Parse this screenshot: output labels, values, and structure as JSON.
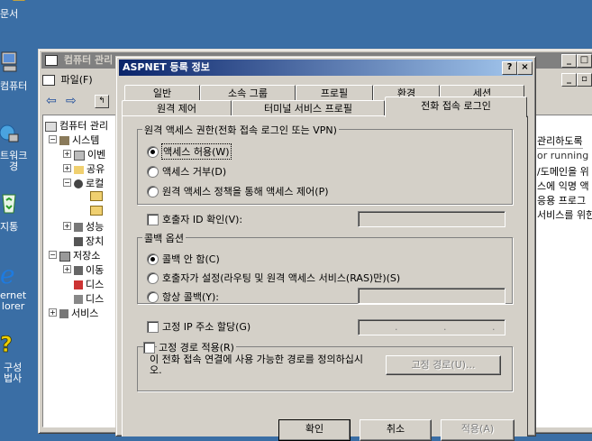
{
  "desktop": {
    "icons": [
      {
        "label": "문서",
        "icon": "my-documents-icon"
      },
      {
        "label": "컴퓨터",
        "icon": "my-computer-icon"
      },
      {
        "label": "트워크\n경",
        "icon": "network-places-icon"
      },
      {
        "label": "지통",
        "icon": "recycle-bin-icon"
      },
      {
        "label": "ernet\nlorer",
        "icon": "internet-explorer-icon"
      },
      {
        "label": "구성\n법사",
        "icon": "configure-server-wizard-icon"
      }
    ]
  },
  "mmc": {
    "title": "컴퓨터 관리",
    "menu_file": "파일(F)",
    "tree": [
      "컴퓨터 관리",
      "시스템",
      "이벤",
      "공유",
      "로컬",
      "성능",
      "장치",
      "저장소",
      "이동",
      "디스",
      "디스",
      "서비스"
    ],
    "right_text": [
      "관리하도록",
      "or running th",
      "/도메인을 위",
      "스에 익명 액",
      "응용 프로그",
      "서비스를 위한"
    ]
  },
  "dialog": {
    "title": "ASPNET 등록 정보",
    "help_btn": "?",
    "close_btn": "×",
    "tabs_row1": [
      "일반",
      "소속 그룹",
      "프로필",
      "환경",
      "세션"
    ],
    "tabs_row2": [
      "원격 제어",
      "터미널 서비스 프로필",
      "전화 접속 로그인"
    ],
    "remote_access": {
      "legend": "원격 액세스 권한(전화 접속 로그인 또는 VPN)",
      "options": [
        "액세스 허용(W)",
        "액세스 거부(D)",
        "원격 액세스 정책을 통해 액세스 제어(P)"
      ],
      "selected": 0
    },
    "caller_id": {
      "label": "호출자 ID 확인(V):",
      "value": ""
    },
    "callback": {
      "legend": "콜백 옵션",
      "options": [
        "콜백 안 함(C)",
        "호출자가 설정(라우팅 및 원격 액세스 서비스(RAS)만)(S)",
        "항상 콜백(Y):"
      ],
      "selected": 0,
      "always_value": ""
    },
    "static_ip": {
      "label": "고정 IP 주소 할당(G)",
      "value": ".   .   ."
    },
    "static_route": {
      "label": "고정 경로 적용(R)",
      "description": "이 전화 접속 연결에 사용 가능한 경로를 정의하십시오.",
      "button": "고정 경로(U)..."
    },
    "footer_buttons": [
      "확인",
      "취소",
      "적용(A)"
    ]
  }
}
